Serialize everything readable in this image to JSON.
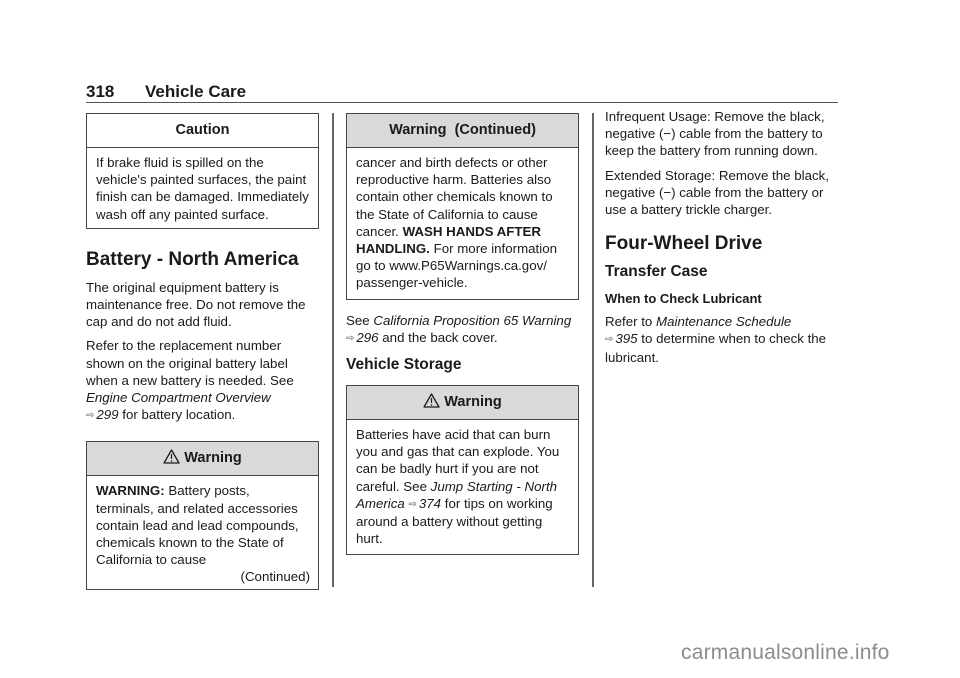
{
  "header": {
    "page_number": "318",
    "section_title": "Vehicle Care"
  },
  "column1": {
    "caution_box": {
      "title": "Caution",
      "text": "If brake fluid is spilled on the vehicle's painted surfaces, the paint finish can be damaged. Immediately wash off any painted surface."
    },
    "battery_heading": "Battery - North America",
    "para1": "The original equipment battery is maintenance free. Do not remove the cap and do not add fluid.",
    "para2": {
      "text_before": "Refer to the replacement number shown on the original battery label when a new battery is needed. See",
      "ref_title": "Engine Compartment Overview",
      "ref_arrow": "⇨",
      "ref_page": "299",
      "text_after": "for battery location."
    },
    "warning_box": {
      "icon": "warning-triangle-icon",
      "title": "Warning",
      "lead_bold": "WARNING:",
      "text": "Battery posts, terminals, and related accessories contain lead and lead compounds, chemicals known to the State of California to cause",
      "continued": "(Continued)"
    }
  },
  "column2": {
    "warning_continued_box": {
      "title": "Warning  (Continued)",
      "text1": "cancer and birth defects or other reproductive harm. Batteries also contain other chemicals known to the State of California to cause cancer.",
      "bold": "WASH HANDS AFTER HANDLING.",
      "text2": "For more information go to www.P65Warnings.ca.gov/ passenger-vehicle."
    },
    "see_para": {
      "text_before": "See",
      "ref_title": "California Proposition 65 Warning",
      "ref_arrow": "⇨",
      "ref_page": "296",
      "text_after": "and the back cover."
    },
    "storage_heading": "Vehicle Storage",
    "storage_warning_box": {
      "icon": "warning-triangle-icon",
      "title": "Warning",
      "text_before": "Batteries have acid that can burn you and gas that can explode. You can be badly hurt if you are not careful. See",
      "ref_title": "Jump Starting - North America",
      "ref_arrow": "⇨",
      "ref_page": "374",
      "text_after": "for tips on working around a battery without getting hurt."
    }
  },
  "column3": {
    "para_infrequent": "Infrequent Usage: Remove the black, negative (−) cable from the battery to keep the battery from running down.",
    "para_extended": "Extended Storage: Remove the black, negative (−) cable from the battery or use a battery trickle charger.",
    "fwd_heading": "Four-Wheel Drive",
    "transfer_heading": "Transfer Case",
    "lubricant_heading": "When to Check Lubricant",
    "lubricant_para": {
      "text_before": "Refer to",
      "ref_title": "Maintenance Schedule",
      "ref_arrow": "⇨",
      "ref_page": "395",
      "text_after": "to determine when to check the lubricant."
    }
  },
  "watermark": "carmanualsonline.info"
}
